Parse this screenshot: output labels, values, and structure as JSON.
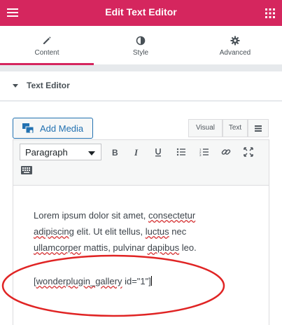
{
  "header": {
    "title": "Edit Text Editor"
  },
  "tabs": [
    {
      "label": "Content",
      "icon": "pencil-icon",
      "active": true
    },
    {
      "label": "Style",
      "icon": "contrast-icon",
      "active": false
    },
    {
      "label": "Advanced",
      "icon": "gear-icon",
      "active": false
    }
  ],
  "section": {
    "title": "Text Editor"
  },
  "editor": {
    "add_media_label": "Add Media",
    "modes": {
      "visual": "Visual",
      "text": "Text"
    },
    "format_value": "Paragraph",
    "toolbar_buttons": [
      "bold",
      "italic",
      "underline",
      "bullet-list",
      "numbered-list",
      "link",
      "fullscreen",
      "toolbar-toggle"
    ],
    "content": {
      "w1": "Lorem ipsum dolor sit amet, ",
      "w2": "consectetur",
      "w3": "adipiscing",
      "w4": " elit. Ut elit tellus, ",
      "w5": "luctus",
      "w6": " nec",
      "w7": "ullamcorper",
      "w8": " mattis, pulvinar ",
      "w9": "dapibus",
      "w10": " leo.",
      "sc_a": "[",
      "sc_b": "wonderplugin_gallery",
      "sc_c": " id=\"1\"]"
    }
  },
  "colors": {
    "brand": "#d5265e",
    "link_blue": "#2271b1",
    "highlight_ellipse": "#e02424"
  }
}
